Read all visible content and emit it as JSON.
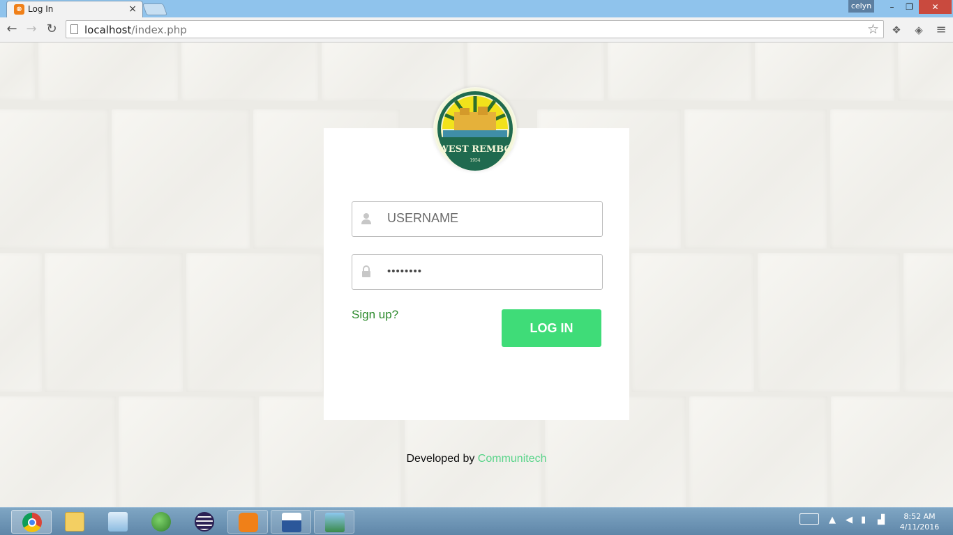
{
  "browser": {
    "tab_title": "Log In",
    "tab_close": "×",
    "user_name": "celyn",
    "url_host": "localhost",
    "url_path": "/index.php",
    "window_buttons": {
      "minimize": "–",
      "restore": "❐",
      "close": "✕"
    }
  },
  "logo": {
    "text": "WEST REMBO",
    "year": "1954"
  },
  "form": {
    "username_placeholder": "USERNAME",
    "password_value": "••••••••",
    "signup_label": "Sign up?",
    "login_label": "LOG IN"
  },
  "footer": {
    "prefix": "Developed by ",
    "brand": "Communitech"
  },
  "taskbar": {
    "time": "8:52 AM",
    "date": "4/11/2016",
    "apps": [
      "chrome",
      "file-explorer",
      "control-panel",
      "internet-download-manager",
      "eclipse",
      "xampp",
      "word",
      "photos"
    ]
  },
  "colors": {
    "accent_green": "#3fdc78",
    "link_green": "#2b8a2b",
    "brand_green": "#5ad48a"
  }
}
